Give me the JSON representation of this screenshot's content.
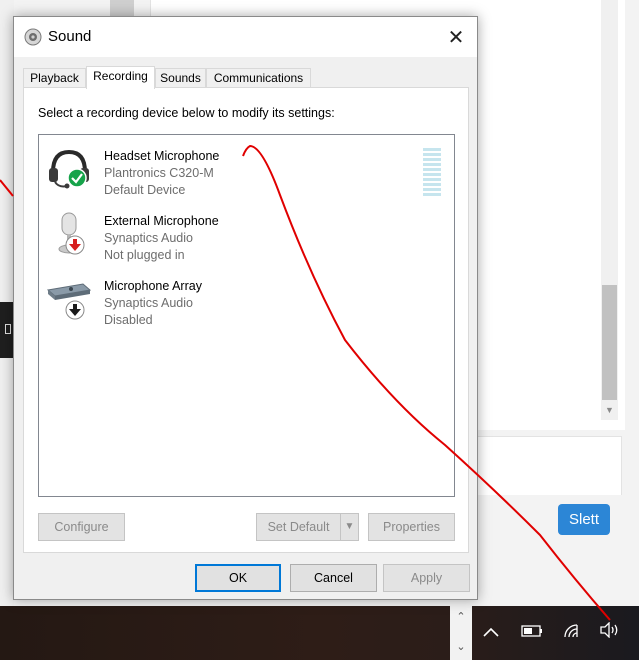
{
  "background": {
    "button_label": "Slett"
  },
  "dialog": {
    "title": "Sound",
    "tabs": [
      {
        "label": "Playback"
      },
      {
        "label": "Recording"
      },
      {
        "label": "Sounds"
      },
      {
        "label": "Communications"
      }
    ],
    "active_tab": "Recording",
    "instruction": "Select a recording device below to modify its settings:",
    "devices": [
      {
        "name": "Headset Microphone",
        "driver": "Plantronics C320-M",
        "status": "Default Device",
        "icon": "headset-icon",
        "badge": "checkmark-badge-icon"
      },
      {
        "name": "External Microphone",
        "driver": "Synaptics Audio",
        "status": "Not plugged in",
        "icon": "microphone-icon",
        "badge": "down-arrow-red-badge-icon"
      },
      {
        "name": "Microphone Array",
        "driver": "Synaptics Audio",
        "status": "Disabled",
        "icon": "microphone-array-icon",
        "badge": "down-arrow-black-badge-icon"
      }
    ],
    "buttons": {
      "configure": "Configure",
      "set_default": "Set Default",
      "properties": "Properties",
      "ok": "OK",
      "cancel": "Cancel",
      "apply": "Apply"
    }
  },
  "taskbar": {
    "icons": [
      "chevron-up-icon",
      "battery-icon",
      "wifi-icon",
      "speaker-icon"
    ]
  },
  "colors": {
    "accent": "#0078d7",
    "slett_button": "#2c86d6",
    "annotation_stroke": "#e00000",
    "level_meter": "#c6e5ee"
  }
}
